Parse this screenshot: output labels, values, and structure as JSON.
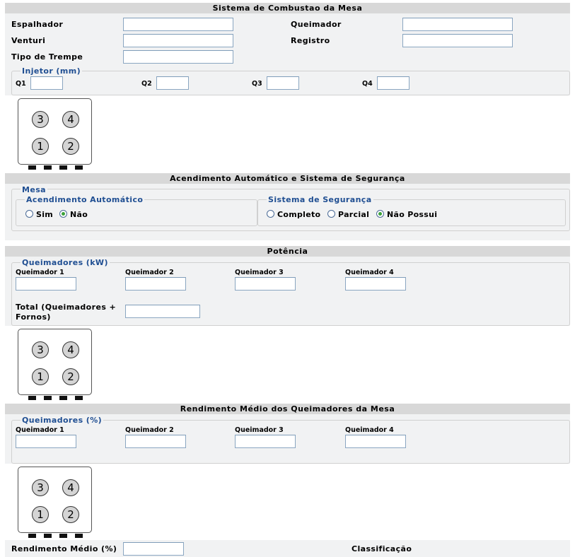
{
  "combustao": {
    "header": "Sistema de Combustao da Mesa",
    "espalhador_label": "Espalhador",
    "venturi_label": "Venturi",
    "tipo_trempe_label": "Tipo de Trempe",
    "queimador_label": "Queimador",
    "registro_label": "Registro",
    "injetor": {
      "legend": "Injetor (mm)",
      "q1_label": "Q1",
      "q2_label": "Q2",
      "q3_label": "Q3",
      "q4_label": "Q4"
    }
  },
  "stove_burners": {
    "b1": "1",
    "b2": "2",
    "b3": "3",
    "b4": "4"
  },
  "acendimento": {
    "header": "Acendimento Automático e Sistema de Segurança",
    "mesa_legend": "Mesa",
    "auto": {
      "legend": "Acendimento Automático",
      "options": [
        {
          "label": "Sim",
          "checked": false
        },
        {
          "label": "Não",
          "checked": true
        }
      ]
    },
    "seguranca": {
      "legend": "Sistema de Segurança",
      "options": [
        {
          "label": "Completo",
          "checked": false
        },
        {
          "label": "Parcial",
          "checked": false
        },
        {
          "label": "Não Possui",
          "checked": true
        }
      ]
    }
  },
  "potencia": {
    "header": "Potência",
    "legend": "Queimadores (kW)",
    "queimador_labels": [
      "Queimador 1",
      "Queimador 2",
      "Queimador 3",
      "Queimador 4"
    ],
    "total_label": "Total (Queimadores + Fornos)"
  },
  "rendimento": {
    "header": "Rendimento Médio dos Queimadores da Mesa",
    "legend": "Queimadores (%)",
    "queimador_labels": [
      "Queimador 1",
      "Queimador 2",
      "Queimador 3",
      "Queimador 4"
    ],
    "medio_label": "Rendimento Médio (%)",
    "classificacao_label": "Classificação"
  }
}
